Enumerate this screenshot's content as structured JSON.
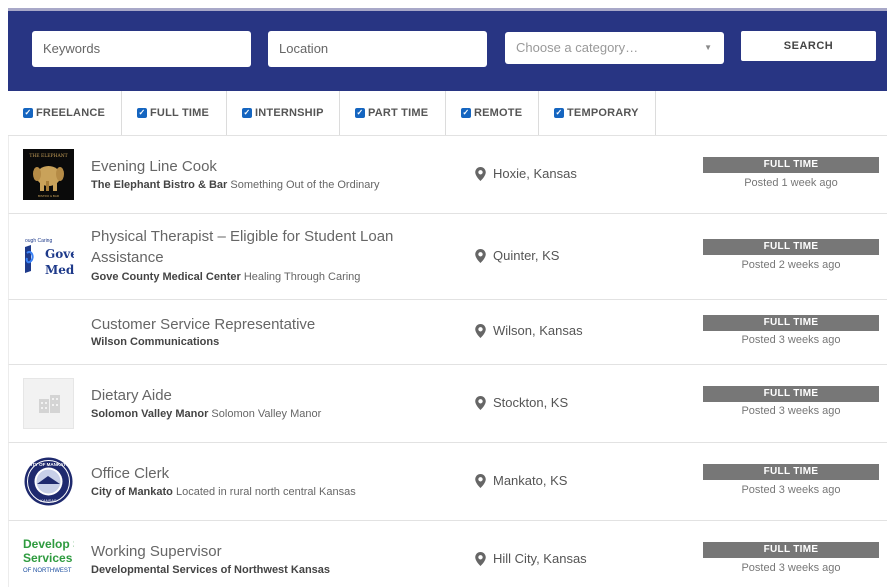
{
  "search": {
    "keywords_placeholder": "Keywords",
    "location_placeholder": "Location",
    "category_placeholder": "Choose a category…",
    "search_label": "SEARCH"
  },
  "filters": [
    {
      "label": "FREELANCE",
      "checked": true
    },
    {
      "label": "FULL TIME",
      "checked": true
    },
    {
      "label": "INTERNSHIP",
      "checked": true
    },
    {
      "label": "PART TIME",
      "checked": true
    },
    {
      "label": "REMOTE",
      "checked": true
    },
    {
      "label": "TEMPORARY",
      "checked": true
    }
  ],
  "jobs": [
    {
      "title": "Evening Line Cook",
      "company": "The Elephant Bistro & Bar",
      "tagline": "Something Out of the Ordinary",
      "location": "Hoxie, Kansas",
      "type": "FULL TIME",
      "posted": "Posted 1 week ago",
      "logo_text": "THE ELEPHANT"
    },
    {
      "title": "Physical Therapist – Eligible for Student Loan Assistance",
      "company": "Gove County Medical Center",
      "tagline": "Healing Through Caring",
      "location": "Quinter, KS",
      "type": "FULL TIME",
      "posted": "Posted 2 weeks ago",
      "logo_text": "Gove Med"
    },
    {
      "title": "Customer Service Representative",
      "company": "Wilson Communications",
      "tagline": "",
      "location": "Wilson, Kansas",
      "type": "FULL TIME",
      "posted": "Posted 3 weeks ago",
      "logo_text": ""
    },
    {
      "title": "Dietary Aide",
      "company": "Solomon Valley Manor",
      "tagline": "Solomon Valley Manor",
      "location": "Stockton, KS",
      "type": "FULL TIME",
      "posted": "Posted 3 weeks ago",
      "logo_text": ""
    },
    {
      "title": "Office Clerk",
      "company": "City of Mankato",
      "tagline": "Located in rural north central Kansas",
      "location": "Mankato, KS",
      "type": "FULL TIME",
      "posted": "Posted 3 weeks ago",
      "logo_text": "CITY OF MANKATO"
    },
    {
      "title": "Working Supervisor",
      "company": "Developmental Services of Northwest Kansas",
      "tagline": "",
      "location": "Hill City, Kansas",
      "type": "FULL TIME",
      "posted": "Posted 3 weeks ago",
      "logo_text": "Develop Services OF NORTHWEST"
    }
  ],
  "colors": {
    "header_bg": "#283583",
    "badge_bg": "#777777",
    "checkbox": "#1565c0"
  }
}
